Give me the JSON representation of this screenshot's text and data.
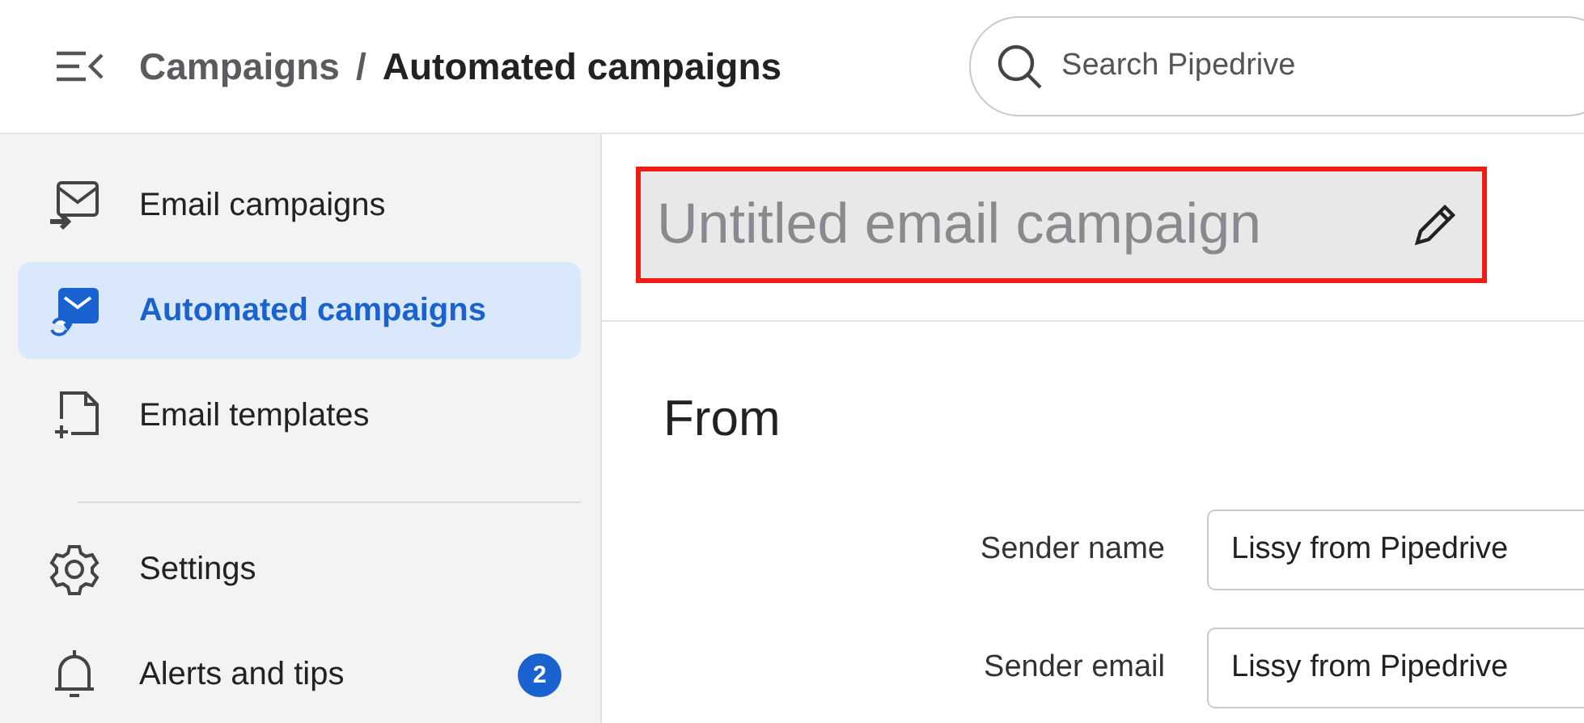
{
  "header": {
    "breadcrumb": [
      {
        "label": "Campaigns",
        "current": false
      },
      {
        "label": "/",
        "current": false
      },
      {
        "label": "Automated campaigns",
        "current": true
      }
    ],
    "search": {
      "placeholder": "Search Pipedrive"
    }
  },
  "sidebar": {
    "items": [
      {
        "kind": "item",
        "label": "Email campaigns",
        "selected": false
      },
      {
        "kind": "item",
        "label": "Automated campaigns",
        "selected": true
      },
      {
        "kind": "item",
        "label": "Email templates",
        "selected": false
      },
      {
        "kind": "divider"
      },
      {
        "kind": "item",
        "label": "Settings",
        "selected": false
      },
      {
        "kind": "item",
        "label": "Alerts and tips",
        "selected": false,
        "badge": "2"
      }
    ]
  },
  "campaign": {
    "title": "Untitled email campaign",
    "highlighted": true
  },
  "section": {
    "title": "From",
    "fields": [
      {
        "label": "Sender name",
        "value": "Lissy from Pipedrive"
      },
      {
        "label": "Sender email",
        "value": "Lissy from Pipedrive"
      }
    ]
  }
}
